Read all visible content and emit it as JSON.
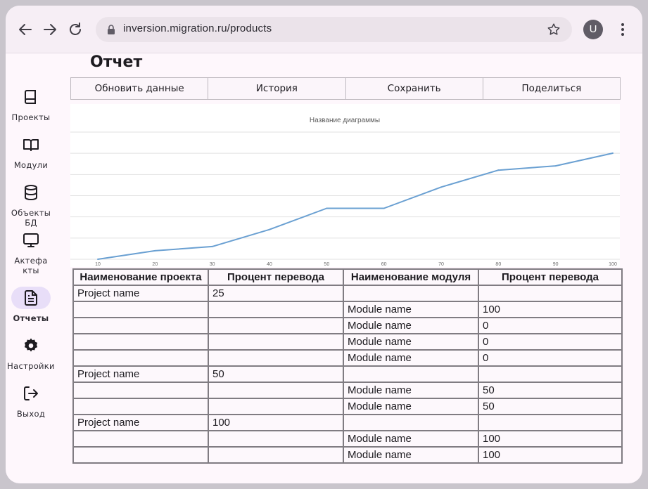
{
  "browser": {
    "url": "inversion.migration.ru/products",
    "avatar_letter": "U"
  },
  "sidebar": {
    "items": [
      {
        "label": "Проекты",
        "icon": "book-icon"
      },
      {
        "label": "Модули",
        "icon": "open-book-icon"
      },
      {
        "label": "Объекты БД",
        "icon": "database-icon"
      },
      {
        "label": "Актефа\nкты",
        "icon": "monitor-icon"
      },
      {
        "label": "Отчеты",
        "icon": "document-icon",
        "active": true
      },
      {
        "label": "Настройки",
        "icon": "gear-icon"
      },
      {
        "label": "Выход",
        "icon": "logout-icon"
      }
    ]
  },
  "page": {
    "title": "Отчет"
  },
  "toolbar": {
    "refresh_label": "Обновить данные",
    "history_label": "История",
    "save_label": "Сохранить",
    "share_label": "Поделиться"
  },
  "chart_data": {
    "type": "line",
    "title": "Название диаграммы",
    "x": [
      10,
      20,
      30,
      40,
      50,
      60,
      70,
      80,
      90,
      100
    ],
    "values": [
      0,
      8,
      12,
      28,
      48,
      48,
      68,
      84,
      88,
      100
    ],
    "ylim": [
      0,
      100
    ],
    "grid": true,
    "line_color": "#6aa0d2"
  },
  "table": {
    "headers": [
      "Наименование проекта",
      "Процент перевода",
      "Наименование модуля",
      "Процент перевода"
    ],
    "rows": [
      [
        "Project name",
        "25",
        "",
        ""
      ],
      [
        "",
        "",
        "Module name",
        "100"
      ],
      [
        "",
        "",
        "Module name",
        "0"
      ],
      [
        "",
        "",
        "Module name",
        "0"
      ],
      [
        "",
        "",
        "Module name",
        "0"
      ],
      [
        "Project name",
        "50",
        "",
        ""
      ],
      [
        "",
        "",
        "Module name",
        "50"
      ],
      [
        "",
        "",
        "Module name",
        "50"
      ],
      [
        "Project name",
        "100",
        "",
        ""
      ],
      [
        "",
        "",
        "Module name",
        "100"
      ],
      [
        "",
        "",
        "Module name",
        "100"
      ]
    ]
  }
}
